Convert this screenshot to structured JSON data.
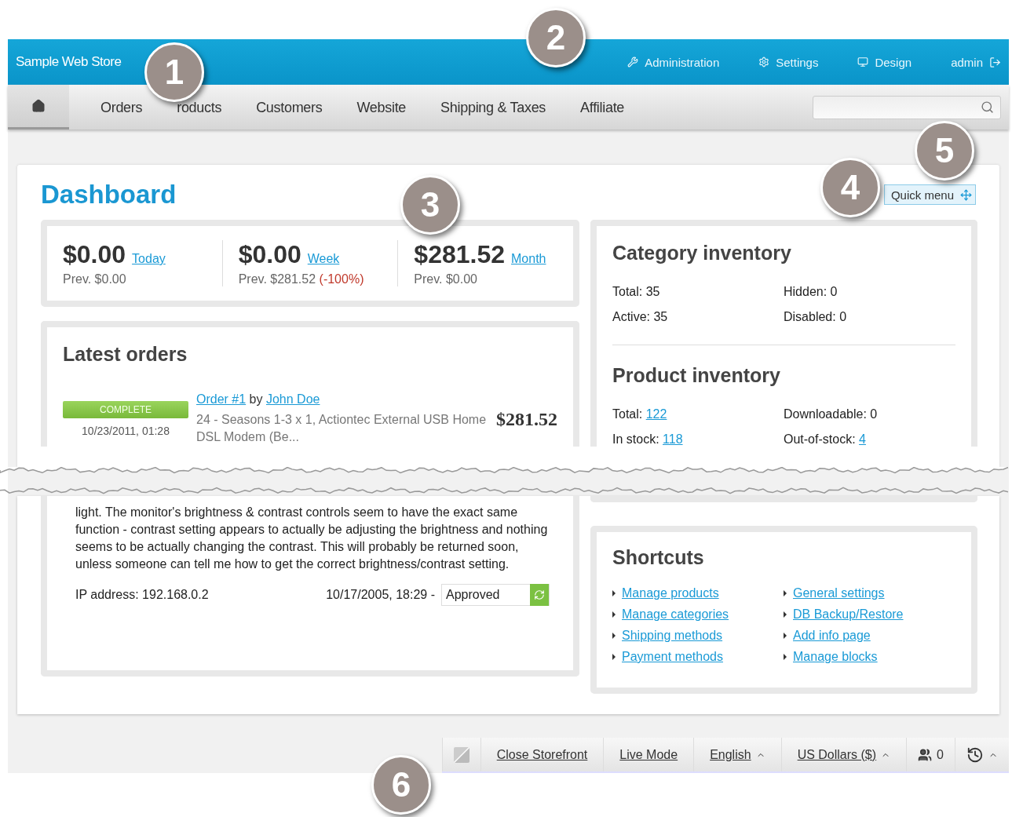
{
  "store_name": "Sample Web Store",
  "top_links": [
    {
      "label": "Administration"
    },
    {
      "label": "Settings"
    },
    {
      "label": "Design"
    }
  ],
  "user": {
    "name": "admin"
  },
  "nav": [
    {
      "kind": "home",
      "selected": true
    },
    {
      "kind": "text",
      "label": "Orders",
      "selected": false
    },
    {
      "kind": "text",
      "label": "roducts",
      "selected": false
    },
    {
      "kind": "text",
      "label": "Customers",
      "selected": false
    },
    {
      "kind": "text",
      "label": "Website",
      "selected": false
    },
    {
      "kind": "text",
      "label": "Shipping & Taxes",
      "selected": false
    },
    {
      "kind": "text",
      "label": "Affiliate",
      "selected": false
    }
  ],
  "page_title": "Dashboard",
  "quick_menu": "Quick menu",
  "stats": [
    {
      "amount": "$0.00",
      "period": "Today",
      "prev": "Prev. $0.00"
    },
    {
      "amount": "$0.00",
      "period": "Week",
      "prev": "Prev. $281.52",
      "change": "(-100%)"
    },
    {
      "amount": "$281.52",
      "period": "Month",
      "prev": "Prev. $0.00"
    }
  ],
  "latest_orders": {
    "title": "Latest orders",
    "order": {
      "status": "COMPLETE",
      "date": "10/23/2011, 01:28",
      "link": "Order #1",
      "by": "by",
      "customer": "John Doe",
      "description": "24 - Seasons 1-3 x 1, Actiontec External USB Home DSL Modem (Be...",
      "total": "$281.52"
    }
  },
  "review": {
    "text": "light. The monitor's brightness & contrast controls seem to have the exact same function - contrast setting appears to actually be adjusting the brightness and nothing seems to be actually changing the contrast. This will probably be returned soon, unless someone can tell me how to get the correct brightness/contrast setting.",
    "ip": "IP address: 192.168.0.2",
    "date": "10/17/2005, 18:29 -",
    "status": "Approved"
  },
  "category_inventory": {
    "title": "Category inventory",
    "items": [
      {
        "label": "Total:",
        "value": "35",
        "linked": false
      },
      {
        "label": "Hidden:",
        "value": "0",
        "linked": false
      },
      {
        "label": "Active:",
        "value": "35",
        "linked": false
      },
      {
        "label": "Disabled:",
        "value": "0",
        "linked": false
      }
    ]
  },
  "product_inventory": {
    "title": "Product inventory",
    "items": [
      {
        "label": "Total:",
        "value": "122",
        "linked": true
      },
      {
        "label": "Downloadable:",
        "value": "0",
        "linked": false
      },
      {
        "label": "In stock:",
        "value": "118",
        "linked": true
      },
      {
        "label": "Out-of-stock:",
        "value": "4",
        "linked": true
      }
    ]
  },
  "shortcuts": {
    "title": "Shortcuts",
    "links": [
      "Manage products",
      "General settings",
      "Manage categories",
      "DB Backup/Restore",
      "Shipping methods",
      "Add info page",
      "Payment methods",
      "Manage blocks"
    ]
  },
  "footer": [
    {
      "kind": "edit"
    },
    {
      "kind": "link",
      "label": "Close Storefront"
    },
    {
      "kind": "link",
      "label": "Live Mode"
    },
    {
      "kind": "dropdown",
      "label": "English"
    },
    {
      "kind": "dropdown",
      "label": "US Dollars ($)"
    },
    {
      "kind": "users",
      "label": "0"
    },
    {
      "kind": "history"
    }
  ],
  "callouts": [
    "1",
    "2",
    "3",
    "4",
    "5",
    "6"
  ]
}
